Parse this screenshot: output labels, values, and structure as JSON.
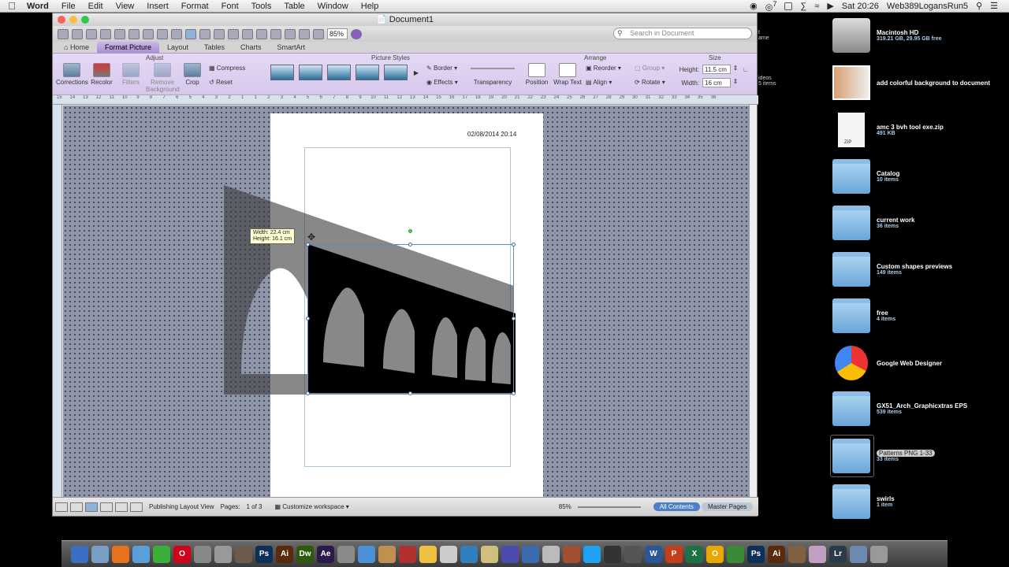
{
  "menubar": {
    "app": "Word",
    "items": [
      "File",
      "Edit",
      "View",
      "Insert",
      "Format",
      "Font",
      "Tools",
      "Table",
      "Window",
      "Help"
    ],
    "clock": "Sat 20:26",
    "user": "Web389LogansRun5",
    "badge": "7"
  },
  "window": {
    "title": "Document1",
    "zoom": "85%",
    "search_placeholder": "Search in Document"
  },
  "tabs": [
    "Home",
    "Format Picture",
    "Layout",
    "Tables",
    "Charts",
    "SmartArt"
  ],
  "active_tab": "Format Picture",
  "ribbon": {
    "groups": [
      "Adjust",
      "Picture Styles",
      "Arrange",
      "Size"
    ],
    "adjust": [
      "Corrections",
      "Recolor",
      "Filters",
      "Remove Background",
      "Crop"
    ],
    "compress": "Compress",
    "reset": "Reset",
    "border": "Border",
    "effects": "Effects",
    "transparency": "Transparency",
    "arrange": [
      "Position",
      "Wrap Text"
    ],
    "reorder": "Reorder",
    "align": "Align",
    "group": "Group",
    "rotate": "Rotate",
    "height_label": "Height:",
    "height_value": "11.5 cm",
    "width_label": "Width:",
    "width_value": "16 cm"
  },
  "ruler_numbers": [
    "15",
    "14",
    "13",
    "12",
    "11",
    "10",
    "9",
    "8",
    "7",
    "6",
    "5",
    "4",
    "3",
    "2",
    "1",
    "1",
    "2",
    "3",
    "4",
    "5",
    "6",
    "7",
    "8",
    "9",
    "10",
    "11",
    "12",
    "13",
    "14",
    "15",
    "16",
    "17",
    "18",
    "19",
    "20",
    "21",
    "22",
    "23",
    "24",
    "25",
    "26",
    "27",
    "28",
    "29",
    "30",
    "31",
    "32",
    "33",
    "34",
    "35",
    "36"
  ],
  "document": {
    "date_text": "02/08/2014 20:14",
    "tooltip_width": "Width: 22.4 cm",
    "tooltip_height": "Height: 16.1 cm"
  },
  "statusbar": {
    "view_name": "Publishing Layout View",
    "pages_label": "Pages:",
    "pages_value": "1 of 3",
    "customize": "Customize workspace",
    "zoom": "85%",
    "all_contents": "All Contents",
    "master_pages": "Master Pages"
  },
  "desktop": {
    "partial_labels": [
      "t",
      "ideos",
      "5 items",
      "ame"
    ],
    "items": [
      {
        "name": "Macintosh HD",
        "sub": "319.21 GB, 29.95 GB free",
        "type": "disk"
      },
      {
        "name": "add colorful background to document",
        "sub": "",
        "type": "image"
      },
      {
        "name": "amc 3 bvh tool exe.zip",
        "sub": "491 KB",
        "type": "zip"
      },
      {
        "name": "Catalog",
        "sub": "10 items",
        "type": "folder"
      },
      {
        "name": "current work",
        "sub": "36 items",
        "type": "folder"
      },
      {
        "name": "Custom shapes previews",
        "sub": "149 items",
        "type": "folder"
      },
      {
        "name": "free",
        "sub": "4 items",
        "type": "folder"
      },
      {
        "name": "Google Web Designer",
        "sub": "",
        "type": "app"
      },
      {
        "name": "GX51_Arch_Graphicxtras EPS",
        "sub": "539 items",
        "type": "folder"
      },
      {
        "name": "Patterns PNG 1-33",
        "sub": "33 items",
        "type": "folder"
      },
      {
        "name": "swirls",
        "sub": "1 item",
        "type": "folder"
      }
    ],
    "zip_label": "ZIP"
  },
  "dock": [
    {
      "label": "",
      "color": "#3a6fc4"
    },
    {
      "label": "",
      "color": "#7a9cc6"
    },
    {
      "label": "",
      "color": "#e8711c"
    },
    {
      "label": "",
      "color": "#5aa0d8"
    },
    {
      "label": "",
      "color": "#3cae3c"
    },
    {
      "label": "O",
      "color": "#d0021b"
    },
    {
      "label": "",
      "color": "#888"
    },
    {
      "label": "",
      "color": "#999"
    },
    {
      "label": "",
      "color": "#6b5b4a"
    },
    {
      "label": "Ps",
      "color": "#0d2f5a"
    },
    {
      "label": "Ai",
      "color": "#5a2a0a"
    },
    {
      "label": "Dw",
      "color": "#2d5a0a"
    },
    {
      "label": "Ae",
      "color": "#2a1a4a"
    },
    {
      "label": "",
      "color": "#8a8a8a"
    },
    {
      "label": "",
      "color": "#4a90d9"
    },
    {
      "label": "",
      "color": "#c09050"
    },
    {
      "label": "",
      "color": "#b03030"
    },
    {
      "label": "",
      "color": "#f0c040"
    },
    {
      "label": "",
      "color": "#ccc"
    },
    {
      "label": "",
      "color": "#3080c0"
    },
    {
      "label": "",
      "color": "#d0c080"
    },
    {
      "label": "",
      "color": "#4a4ab0"
    },
    {
      "label": "",
      "color": "#3a6ab0"
    },
    {
      "label": "",
      "color": "#bbb"
    },
    {
      "label": "",
      "color": "#a05030"
    },
    {
      "label": "",
      "color": "#1da1f2"
    },
    {
      "label": "",
      "color": "#333"
    },
    {
      "label": "",
      "color": "#555"
    },
    {
      "label": "W",
      "color": "#2b5797"
    },
    {
      "label": "P",
      "color": "#c43e1c"
    },
    {
      "label": "X",
      "color": "#1e7145"
    },
    {
      "label": "O",
      "color": "#e8a800"
    },
    {
      "label": "",
      "color": "#3a8a3a"
    },
    {
      "label": "Ps",
      "color": "#0d2f5a"
    },
    {
      "label": "Ai",
      "color": "#5a2a0a"
    },
    {
      "label": "",
      "color": "#806040"
    },
    {
      "label": "",
      "color": "#c0a0c0"
    },
    {
      "label": "Lr",
      "color": "#2a3a4a"
    },
    {
      "label": "",
      "color": "#6a8ab0"
    },
    {
      "label": "",
      "color": "#999"
    }
  ],
  "colors": {
    "ribbon_accent": "#a98fd3",
    "canvas_bg": "#8f96a8",
    "dock_bg": "#4a4a4a"
  }
}
